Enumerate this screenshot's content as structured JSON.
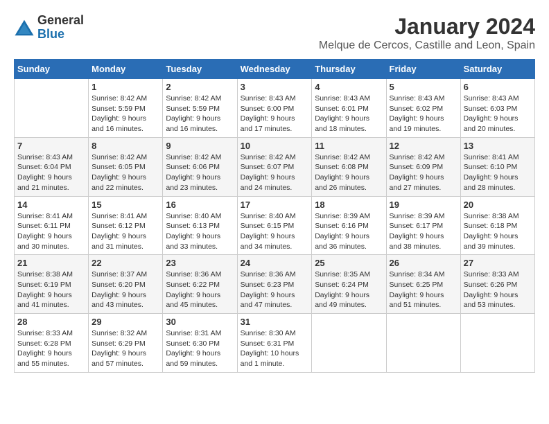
{
  "logo": {
    "general": "General",
    "blue": "Blue"
  },
  "title": {
    "month_year": "January 2024",
    "location": "Melque de Cercos, Castille and Leon, Spain"
  },
  "calendar": {
    "headers": [
      "Sunday",
      "Monday",
      "Tuesday",
      "Wednesday",
      "Thursday",
      "Friday",
      "Saturday"
    ],
    "weeks": [
      [
        {
          "day": "",
          "info": ""
        },
        {
          "day": "1",
          "info": "Sunrise: 8:42 AM\nSunset: 5:59 PM\nDaylight: 9 hours\nand 16 minutes."
        },
        {
          "day": "2",
          "info": "Sunrise: 8:42 AM\nSunset: 5:59 PM\nDaylight: 9 hours\nand 16 minutes."
        },
        {
          "day": "3",
          "info": "Sunrise: 8:43 AM\nSunset: 6:00 PM\nDaylight: 9 hours\nand 17 minutes."
        },
        {
          "day": "4",
          "info": "Sunrise: 8:43 AM\nSunset: 6:01 PM\nDaylight: 9 hours\nand 18 minutes."
        },
        {
          "day": "5",
          "info": "Sunrise: 8:43 AM\nSunset: 6:02 PM\nDaylight: 9 hours\nand 19 minutes."
        },
        {
          "day": "6",
          "info": "Sunrise: 8:43 AM\nSunset: 6:03 PM\nDaylight: 9 hours\nand 20 minutes."
        }
      ],
      [
        {
          "day": "7",
          "info": "Sunrise: 8:43 AM\nSunset: 6:04 PM\nDaylight: 9 hours\nand 21 minutes."
        },
        {
          "day": "8",
          "info": "Sunrise: 8:42 AM\nSunset: 6:05 PM\nDaylight: 9 hours\nand 22 minutes."
        },
        {
          "day": "9",
          "info": "Sunrise: 8:42 AM\nSunset: 6:06 PM\nDaylight: 9 hours\nand 23 minutes."
        },
        {
          "day": "10",
          "info": "Sunrise: 8:42 AM\nSunset: 6:07 PM\nDaylight: 9 hours\nand 24 minutes."
        },
        {
          "day": "11",
          "info": "Sunrise: 8:42 AM\nSunset: 6:08 PM\nDaylight: 9 hours\nand 26 minutes."
        },
        {
          "day": "12",
          "info": "Sunrise: 8:42 AM\nSunset: 6:09 PM\nDaylight: 9 hours\nand 27 minutes."
        },
        {
          "day": "13",
          "info": "Sunrise: 8:41 AM\nSunset: 6:10 PM\nDaylight: 9 hours\nand 28 minutes."
        }
      ],
      [
        {
          "day": "14",
          "info": "Sunrise: 8:41 AM\nSunset: 6:11 PM\nDaylight: 9 hours\nand 30 minutes."
        },
        {
          "day": "15",
          "info": "Sunrise: 8:41 AM\nSunset: 6:12 PM\nDaylight: 9 hours\nand 31 minutes."
        },
        {
          "day": "16",
          "info": "Sunrise: 8:40 AM\nSunset: 6:13 PM\nDaylight: 9 hours\nand 33 minutes."
        },
        {
          "day": "17",
          "info": "Sunrise: 8:40 AM\nSunset: 6:15 PM\nDaylight: 9 hours\nand 34 minutes."
        },
        {
          "day": "18",
          "info": "Sunrise: 8:39 AM\nSunset: 6:16 PM\nDaylight: 9 hours\nand 36 minutes."
        },
        {
          "day": "19",
          "info": "Sunrise: 8:39 AM\nSunset: 6:17 PM\nDaylight: 9 hours\nand 38 minutes."
        },
        {
          "day": "20",
          "info": "Sunrise: 8:38 AM\nSunset: 6:18 PM\nDaylight: 9 hours\nand 39 minutes."
        }
      ],
      [
        {
          "day": "21",
          "info": "Sunrise: 8:38 AM\nSunset: 6:19 PM\nDaylight: 9 hours\nand 41 minutes."
        },
        {
          "day": "22",
          "info": "Sunrise: 8:37 AM\nSunset: 6:20 PM\nDaylight: 9 hours\nand 43 minutes."
        },
        {
          "day": "23",
          "info": "Sunrise: 8:36 AM\nSunset: 6:22 PM\nDaylight: 9 hours\nand 45 minutes."
        },
        {
          "day": "24",
          "info": "Sunrise: 8:36 AM\nSunset: 6:23 PM\nDaylight: 9 hours\nand 47 minutes."
        },
        {
          "day": "25",
          "info": "Sunrise: 8:35 AM\nSunset: 6:24 PM\nDaylight: 9 hours\nand 49 minutes."
        },
        {
          "day": "26",
          "info": "Sunrise: 8:34 AM\nSunset: 6:25 PM\nDaylight: 9 hours\nand 51 minutes."
        },
        {
          "day": "27",
          "info": "Sunrise: 8:33 AM\nSunset: 6:26 PM\nDaylight: 9 hours\nand 53 minutes."
        }
      ],
      [
        {
          "day": "28",
          "info": "Sunrise: 8:33 AM\nSunset: 6:28 PM\nDaylight: 9 hours\nand 55 minutes."
        },
        {
          "day": "29",
          "info": "Sunrise: 8:32 AM\nSunset: 6:29 PM\nDaylight: 9 hours\nand 57 minutes."
        },
        {
          "day": "30",
          "info": "Sunrise: 8:31 AM\nSunset: 6:30 PM\nDaylight: 9 hours\nand 59 minutes."
        },
        {
          "day": "31",
          "info": "Sunrise: 8:30 AM\nSunset: 6:31 PM\nDaylight: 10 hours\nand 1 minute."
        },
        {
          "day": "",
          "info": ""
        },
        {
          "day": "",
          "info": ""
        },
        {
          "day": "",
          "info": ""
        }
      ]
    ]
  }
}
